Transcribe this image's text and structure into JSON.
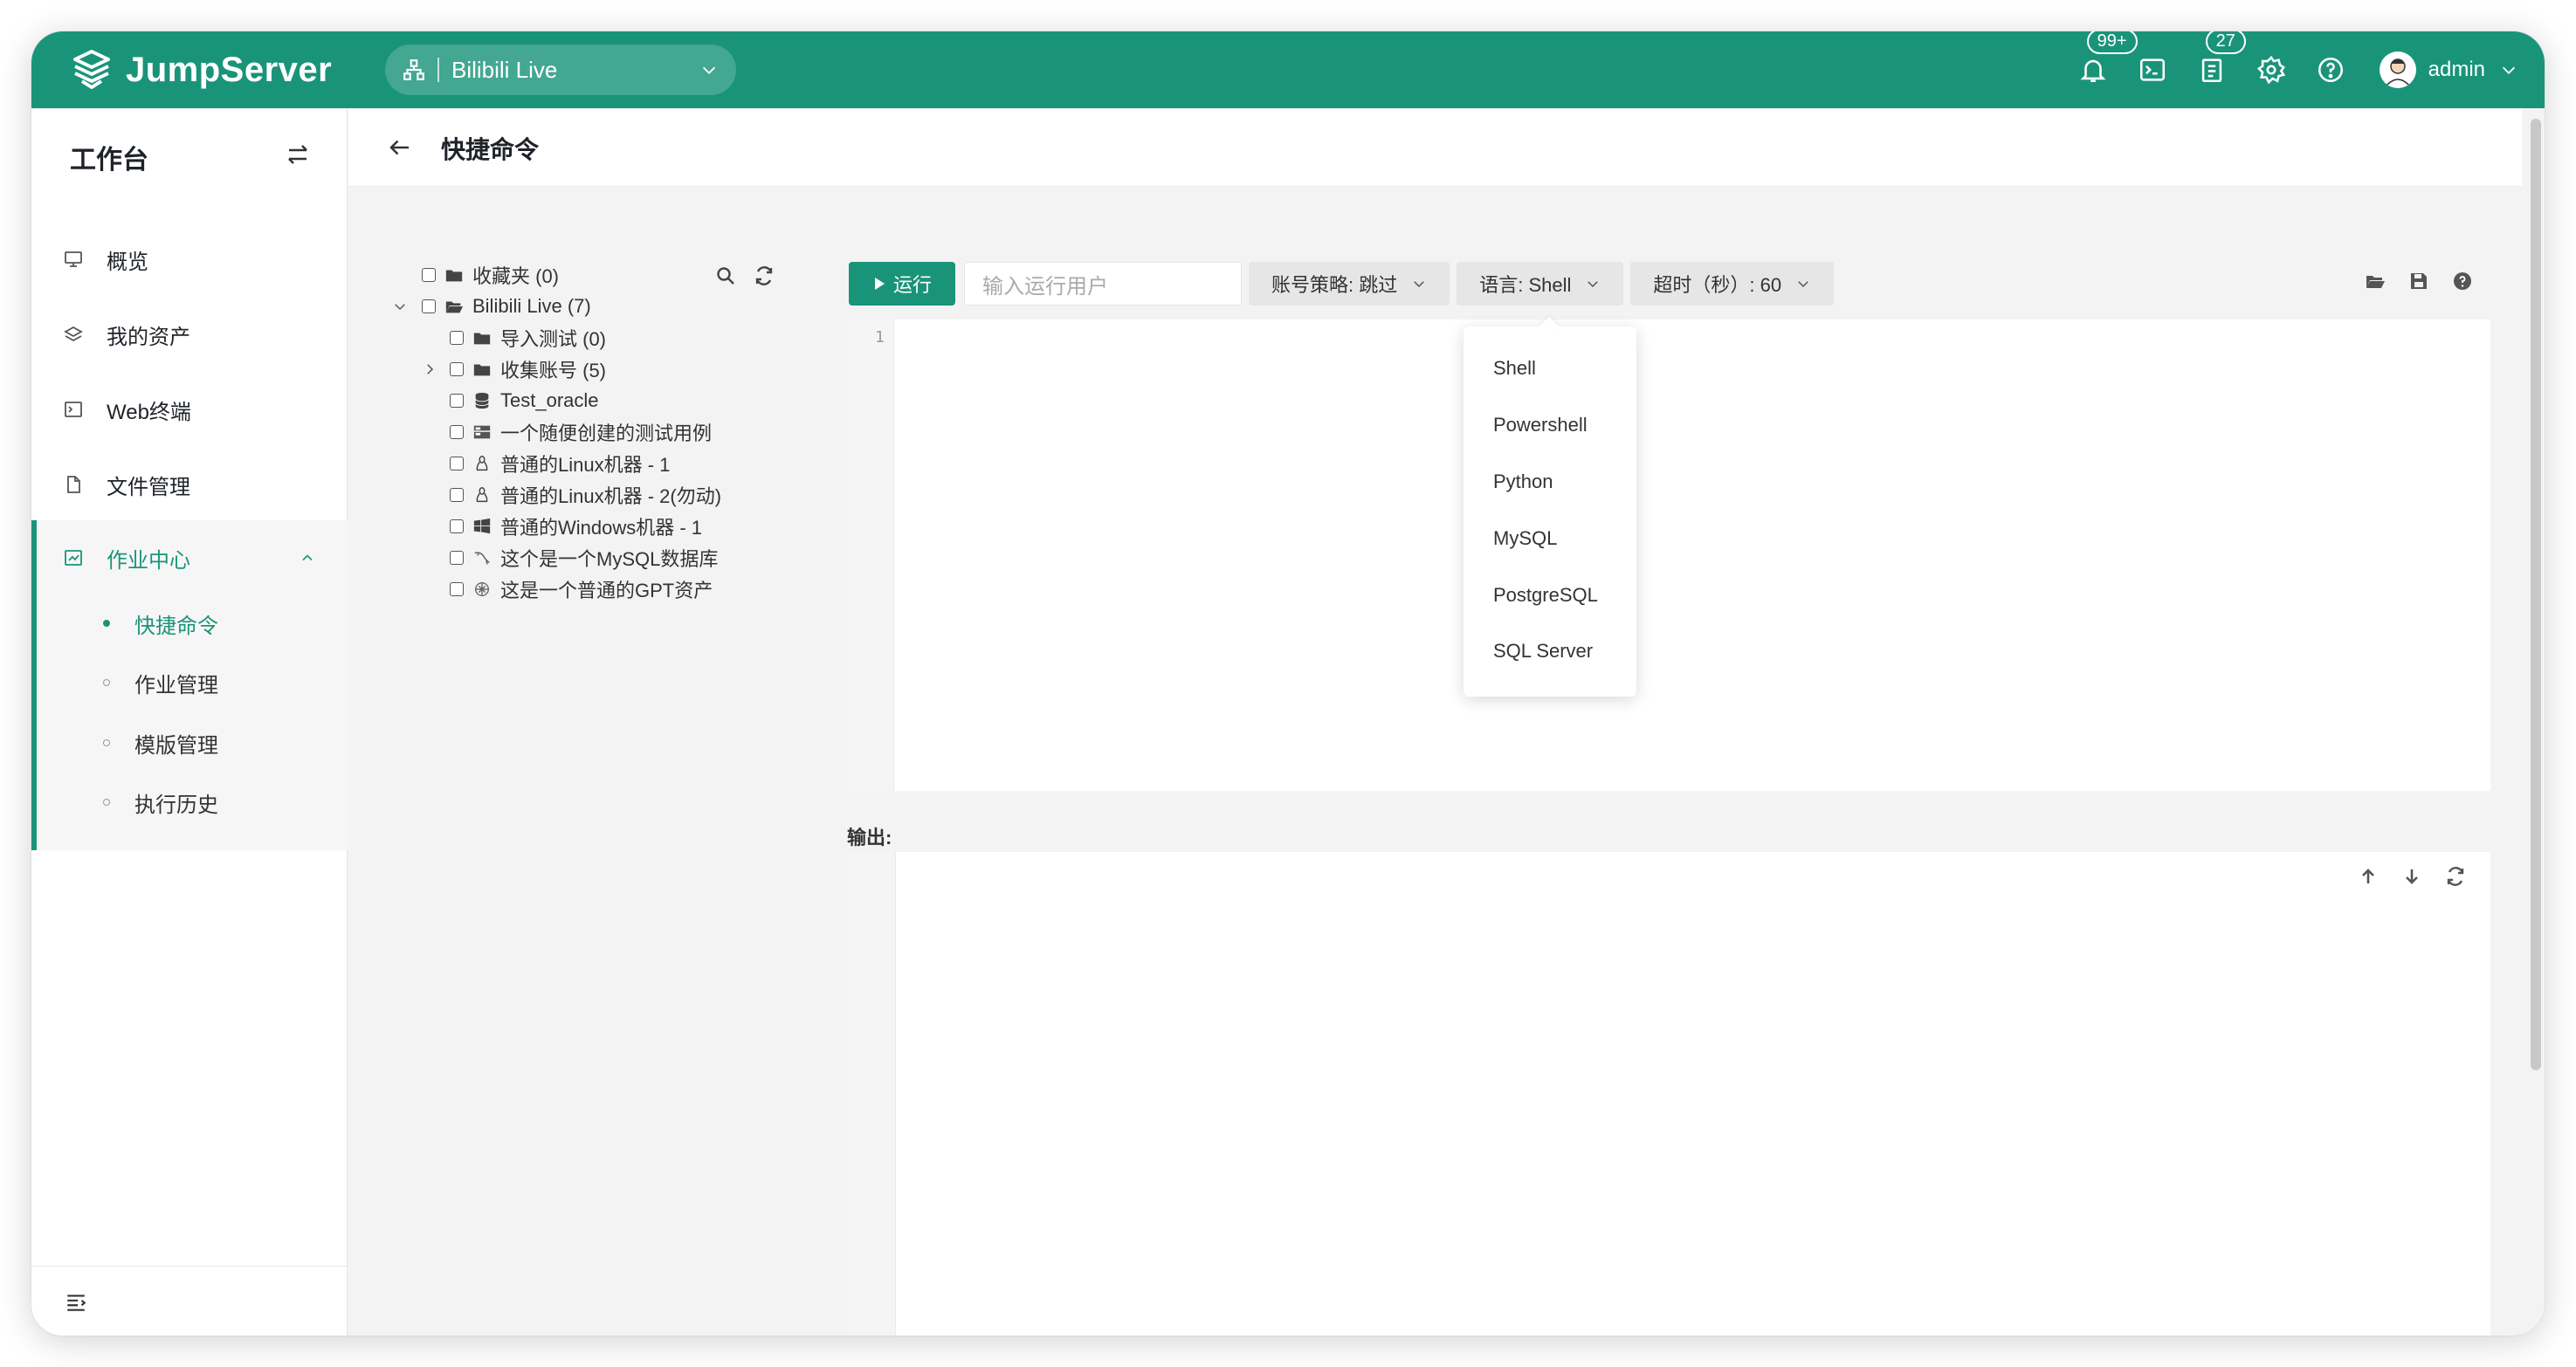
{
  "app": {
    "name": "JumpServer"
  },
  "org": {
    "name": "Bilibili Live"
  },
  "header": {
    "notifications_badge": "99+",
    "tickets_badge": "27",
    "user": "admin"
  },
  "sidebar": {
    "title": "工作台",
    "items": [
      {
        "label": "概览",
        "icon": "monitor-icon"
      },
      {
        "label": "我的资产",
        "icon": "layers-icon"
      },
      {
        "label": "Web终端",
        "icon": "terminal-icon"
      },
      {
        "label": "文件管理",
        "icon": "file-icon"
      }
    ],
    "group": {
      "label": "作业中心",
      "children": [
        {
          "label": "快捷命令",
          "active": true
        },
        {
          "label": "作业管理",
          "active": false
        },
        {
          "label": "模版管理",
          "active": false
        },
        {
          "label": "执行历史",
          "active": false
        }
      ]
    }
  },
  "page": {
    "title": "快捷命令"
  },
  "tree": {
    "nodes": [
      {
        "label": "收藏夹 (0)",
        "icon": "folder-icon"
      },
      {
        "label": "Bilibili Live (7)",
        "icon": "folder-open-icon"
      },
      {
        "label": "导入测试 (0)",
        "icon": "folder-icon"
      },
      {
        "label": "收集账号 (5)",
        "icon": "folder-icon"
      },
      {
        "label": "Test_oracle",
        "icon": "database-icon"
      },
      {
        "label": "一个随便创建的测试用例",
        "icon": "server-icon"
      },
      {
        "label": "普通的Linux机器 - 1",
        "icon": "linux-icon"
      },
      {
        "label": "普通的Linux机器 - 2(勿动)",
        "icon": "linux-icon"
      },
      {
        "label": "普通的Windows机器 - 1",
        "icon": "windows-icon"
      },
      {
        "label": "这个是一个MySQL数据库",
        "icon": "mysql-icon"
      },
      {
        "label": "这是一个普通的GPT资产",
        "icon": "gpt-icon"
      }
    ]
  },
  "toolbar": {
    "run_label": "运行",
    "user_placeholder": "输入运行用户",
    "account_policy": "账号策略: 跳过",
    "language": "语言: Shell",
    "timeout": "超时（秒）: 60"
  },
  "editor": {
    "line_number": "1"
  },
  "language_menu": {
    "options": [
      "Shell",
      "Powershell",
      "Python",
      "MySQL",
      "PostgreSQL",
      "SQL Server"
    ]
  },
  "output": {
    "label": "输出:"
  }
}
